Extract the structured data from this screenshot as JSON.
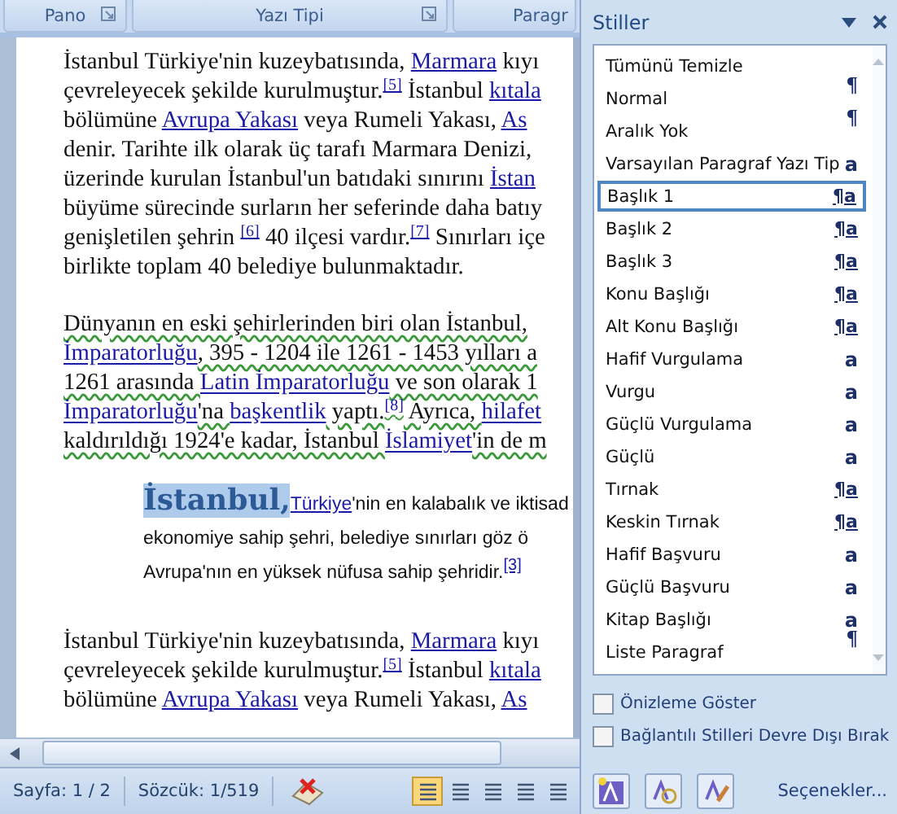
{
  "ribbon_groups": [
    {
      "label": "Pano",
      "launcher": true
    },
    {
      "label": "Yazı Tipi",
      "launcher": true
    },
    {
      "label": "Paragr",
      "launcher": false
    }
  ],
  "document": {
    "paragraphs": [
      {
        "kind": "body",
        "grammar_flag": false,
        "lines": [
          [
            {
              "kind": "plain",
              "text": "İstanbul Türkiye'nin kuzeybatısında, "
            },
            {
              "kind": "link",
              "text": "Marmara"
            },
            {
              "kind": "plain",
              "text": " kıyı"
            }
          ],
          [
            {
              "kind": "plain",
              "text": "çevreleyecek şekilde kurulmuştur."
            },
            {
              "kind": "ref",
              "text": "[5]"
            },
            {
              "kind": "plain",
              "text": " İstanbul "
            },
            {
              "kind": "link",
              "text": "kıtala"
            }
          ],
          [
            {
              "kind": "plain",
              "text": "bölümüne "
            },
            {
              "kind": "link",
              "text": "Avrupa Yakası"
            },
            {
              "kind": "plain",
              "text": " veya Rumeli Yakası, "
            },
            {
              "kind": "link",
              "text": "As"
            }
          ],
          [
            {
              "kind": "plain",
              "text": "denir. Tarihte ilk olarak üç tarafı Marmara Denizi,"
            }
          ],
          [
            {
              "kind": "plain",
              "text": "üzerinde kurulan İstanbul'un batıdaki sınırını "
            },
            {
              "kind": "link",
              "text": "İstan"
            }
          ],
          [
            {
              "kind": "plain",
              "text": "büyüme sürecinde surların her seferinde daha batıy"
            }
          ],
          [
            {
              "kind": "plain",
              "text": "genişletilen şehrin "
            },
            {
              "kind": "ref",
              "text": "[6]"
            },
            {
              "kind": "plain",
              "text": " 40 ilçesi vardır."
            },
            {
              "kind": "ref",
              "text": "[7]"
            },
            {
              "kind": "plain",
              "text": " Sınırları içe"
            }
          ],
          [
            {
              "kind": "plain",
              "text": "birlikte toplam 40 belediye bulunmaktadır."
            }
          ]
        ]
      },
      {
        "kind": "body",
        "grammar_flag": true,
        "lines": [
          [
            {
              "kind": "plain",
              "text": "Dünyanın en eski şehirlerinden biri olan İstanbul,"
            }
          ],
          [
            {
              "kind": "link",
              "text": "İmparatorluğu"
            },
            {
              "kind": "plain",
              "text": ", 395 - 1204 ile 1261 - 1453 yılları a"
            }
          ],
          [
            {
              "kind": "plain",
              "text": "1261 arasında "
            },
            {
              "kind": "link",
              "text": "Latin İmparatorluğu"
            },
            {
              "kind": "plain",
              "text": " ve son olarak 1"
            }
          ],
          [
            {
              "kind": "link",
              "text": "İmparatorluğu"
            },
            {
              "kind": "plain",
              "text": "'na "
            },
            {
              "kind": "link",
              "text": "başkentlik"
            },
            {
              "kind": "plain",
              "text": " yaptı."
            },
            {
              "kind": "ref",
              "text": "[8]"
            },
            {
              "kind": "plain",
              "text": " Ayrıca, "
            },
            {
              "kind": "link",
              "text": "hilafet"
            }
          ],
          [
            {
              "kind": "plain",
              "text": "kaldırıldığı 1924'e kadar, İstanbul "
            },
            {
              "kind": "link",
              "text": "İslamiyet"
            },
            {
              "kind": "plain",
              "text": "'in de m"
            }
          ]
        ]
      },
      {
        "kind": "quote",
        "grammar_flag": false,
        "lines": [
          [
            {
              "kind": "title",
              "text": "İstanbul,",
              "selected": true
            },
            {
              "kind": "link",
              "text": "Türkiye"
            },
            {
              "kind": "plain",
              "text": "'nin en kalabalık ve iktisad"
            }
          ],
          [
            {
              "kind": "plain",
              "text": "ekonomiye sahip şehri, belediye sınırları göz ö"
            }
          ],
          [
            {
              "kind": "plain",
              "text": "Avrupa'nın en yüksek nüfusa sahip şehridir."
            },
            {
              "kind": "ref",
              "text": "[3]"
            }
          ]
        ]
      },
      {
        "kind": "body",
        "grammar_flag": false,
        "lines": [
          [
            {
              "kind": "plain",
              "text": "İstanbul Türkiye'nin kuzeybatısında, "
            },
            {
              "kind": "link",
              "text": "Marmara"
            },
            {
              "kind": "plain",
              "text": " kıyı"
            }
          ],
          [
            {
              "kind": "plain",
              "text": "çevreleyecek şekilde kurulmuştur."
            },
            {
              "kind": "ref",
              "text": "[5]"
            },
            {
              "kind": "plain",
              "text": " İstanbul "
            },
            {
              "kind": "link",
              "text": "kıtala"
            }
          ],
          [
            {
              "kind": "plain",
              "text": "bölümüne "
            },
            {
              "kind": "link",
              "text": "Avrupa Yakası"
            },
            {
              "kind": "plain",
              "text": " veya Rumeli Yakası, "
            },
            {
              "kind": "link",
              "text": "As"
            }
          ]
        ]
      }
    ]
  },
  "status_bar": {
    "page": "Sayfa: 1 / 2",
    "words": "Sözcük: 1/519",
    "views": [
      {
        "selected": true
      },
      {
        "selected": false
      },
      {
        "selected": false
      },
      {
        "selected": false
      },
      {
        "selected": false
      }
    ]
  },
  "styles_pane": {
    "title": "Stiller",
    "items": [
      {
        "name": "Tümünü Temizle",
        "selected": false
      },
      {
        "name": "Normal",
        "kind": "paragraph",
        "mark": "¶",
        "selected": false
      },
      {
        "name": "Aralık Yok",
        "kind": "paragraph",
        "mark": "¶",
        "selected": false
      },
      {
        "name": "Varsayılan Paragraf Yazı Tip",
        "kind": "character",
        "mark": "a",
        "selected": false
      },
      {
        "name": "Başlık 1",
        "kind": "linked",
        "mark": "¶a",
        "selected": true
      },
      {
        "name": "Başlık 2",
        "kind": "linked",
        "mark": "¶a",
        "selected": false
      },
      {
        "name": "Başlık 3",
        "kind": "linked",
        "mark": "¶a",
        "selected": false
      },
      {
        "name": "Konu Başlığı",
        "kind": "linked",
        "mark": "¶a",
        "selected": false
      },
      {
        "name": "Alt Konu Başlığı",
        "kind": "linked",
        "mark": "¶a",
        "selected": false
      },
      {
        "name": "Hafif Vurgulama",
        "kind": "character",
        "mark": "a",
        "selected": false
      },
      {
        "name": "Vurgu",
        "kind": "character",
        "mark": "a",
        "selected": false
      },
      {
        "name": "Güçlü Vurgulama",
        "kind": "character",
        "mark": "a",
        "selected": false
      },
      {
        "name": "Güçlü",
        "kind": "character",
        "mark": "a",
        "selected": false
      },
      {
        "name": "Tırnak",
        "kind": "linked",
        "mark": "¶a",
        "selected": false
      },
      {
        "name": "Keskin Tırnak",
        "kind": "linked",
        "mark": "¶a",
        "selected": false
      },
      {
        "name": "Hafif Başvuru",
        "kind": "character",
        "mark": "a",
        "selected": false
      },
      {
        "name": "Güçlü Başvuru",
        "kind": "character",
        "mark": "a",
        "selected": false
      },
      {
        "name": "Kitap Başlığı",
        "kind": "character",
        "mark": "a",
        "selected": false
      },
      {
        "name": "Liste Paragraf",
        "kind": "paragraph",
        "mark": "¶",
        "selected": false
      }
    ],
    "options": [
      {
        "label": "Önizleme Göster",
        "checked": false
      },
      {
        "label": "Bağlantılı Stilleri Devre Dışı Bırak",
        "checked": false
      }
    ],
    "options_link": "Seçenekler..."
  }
}
